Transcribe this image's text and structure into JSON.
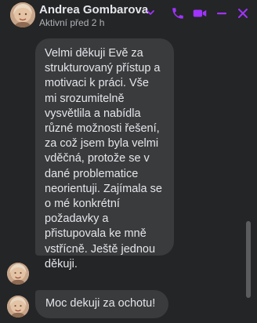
{
  "header": {
    "contact_name": "Andrea Gombarova",
    "status": "Aktivní před 2 h",
    "icons": [
      "chevron-down-icon",
      "phone-icon",
      "video-icon",
      "minimize-icon",
      "close-icon"
    ]
  },
  "messages": [
    {
      "sender": "Andrea Gombarova",
      "text": "Velmi děkuji Evě za\nstrukturovaný přístup a\nmotivaci k práci. Vše\nmi srozumitelně\nvysvětlila a nabídla\nrůzné možnosti řešení,\nza což jsem byla velmi\nvděčná, protože se v\ndané problematice\nneorientuji. Zajímala se\no mé konkrétní\npožadavky a\npřistupovala ke mně\nvstřícně. Ještě jednou\nděkuji."
    },
    {
      "sender": "Andrea Gombarova",
      "text": "Moc dekuji za ochotu!"
    }
  ],
  "colors": {
    "background": "#242526",
    "bubble": "#3a3b3c",
    "accent": "#a033ff",
    "text": "#e4e6eb",
    "secondary_text": "#b0b3b8"
  }
}
